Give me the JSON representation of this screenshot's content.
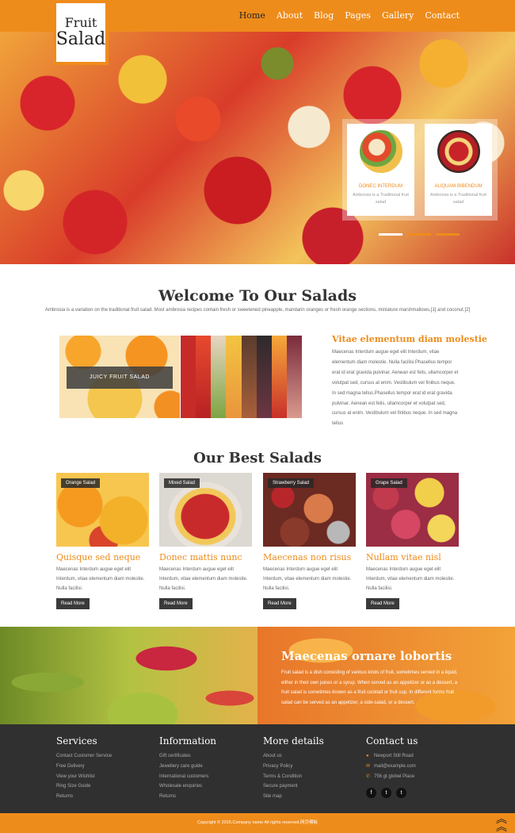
{
  "logo": {
    "line1": "Fruit",
    "line2": "Salad"
  },
  "nav": {
    "items": [
      "Home",
      "About",
      "Blog",
      "Pages",
      "Gallery",
      "Contact"
    ],
    "active": "Home"
  },
  "slider": {
    "cards": [
      {
        "title": "DONEC INTERDUM",
        "text": "Ambrosia is a Traditional fruit salad"
      },
      {
        "title": "ALIQUAM BIBENDUM",
        "text": "Ambrosia is a Traditional fruit salad"
      }
    ]
  },
  "welcome": {
    "title": "Welcome To Our Salads",
    "text": "Ambrosia is a variation on the traditional fruit salad. Most ambrosia recipes contain fresh or sweetened pineapple, mandarin oranges or fresh orange sections, miniature marshmallows,[1] and coconut.[2]",
    "image_label": "JUICY FRUIT SALAD",
    "side_title": "Vitae elementum diam molestie",
    "side_text": "Maecenas Interdum augue eget elit Interdum, vitae elementum diam molestie. Nulla facilisi.Phasellus tempor erat id erat gravida pulvinar. Aenean est felis, ullamcorper et volutpat sed, cursus at enim. Vestibulum vel finibus neque. In sed magna tellus.Phasellus tempor erat id erat gravida pulvinar. Aenean est felis, ullamcorper et volutpat sed, cursus at enim. Vestibulum vel finibus neque. In sed magna tellus"
  },
  "best": {
    "title": "Our Best Salads",
    "cards": [
      {
        "tag": "Orange Salad",
        "title": "Quisque sed neque",
        "text": "Maecenas Interdum augue eget elit Interdum, vitae elementum diam molestie. Nulla facilisi.",
        "button": "Read More"
      },
      {
        "tag": "Mixed Salad",
        "title": "Donec mattis nunc",
        "text": "Maecenas Interdum augue eget elit Interdum, vitae elementum diam molestie. Nulla facilisi.",
        "button": "Read More"
      },
      {
        "tag": "Strawberry Salad",
        "title": "Maecenas non risus",
        "text": "Maecenas Interdum augue eget elit Interdum, vitae elementum diam molestie. Nulla facilisi.",
        "button": "Read More"
      },
      {
        "tag": "Grape Salad",
        "title": "Nullam vitae nisl",
        "text": "Maecenas Interdum augue eget elit Interdum, vitae elementum diam molestie. Nulla facilisi.",
        "button": "Read More"
      }
    ]
  },
  "banner": {
    "title": "Maecenas ornare lobortis",
    "text": "Fruit salad is a dish consisting of various kinds of fruit, sometimes served in a liquid, either in their own juices or a syrup. When served as an appetizer or as a dessert, a fruit salad is sometimes known as a fruit cocktail or fruit cup. In different forms fruit salad can be served as an appetizer, a side-salad, or a dessert."
  },
  "footer": {
    "services": {
      "title": "Services",
      "items": [
        "Contact Customer Service",
        "Free Delivery",
        "View your Wishlist",
        "Ring Size Guide",
        "Returns"
      ]
    },
    "information": {
      "title": "Information",
      "items": [
        "Gift certificates",
        "Jewellery care guide",
        "International customers",
        "Wholesale enquiries",
        "Returns"
      ]
    },
    "more": {
      "title": "More details",
      "items": [
        "About us",
        "Privacy Policy",
        "Terms & Condition",
        "Secure payment",
        "Site map"
      ]
    },
    "contact": {
      "title": "Contact us",
      "address": "Newport Still Road",
      "email": "mail@example.com",
      "place": "756 gt globel Place"
    },
    "social": [
      "f",
      "t",
      "t"
    ],
    "copyright": "Copyright © 2015.Company name All rights reserved.网页模板"
  },
  "colors": {
    "accent": "#ee8c1b",
    "dark": "#303030"
  }
}
